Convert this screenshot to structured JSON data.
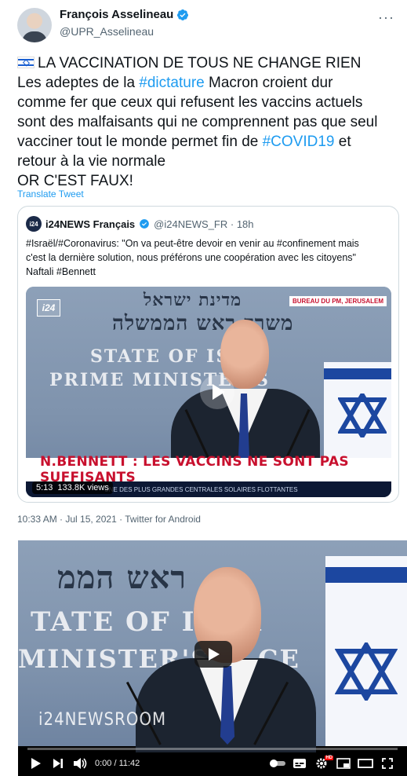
{
  "tweet": {
    "author_name": "François Asselineau",
    "handle": "@UPR_Asselineau",
    "more_label": "···",
    "lines": [
      {
        "before": "LA VACCINATION DE TOUS NE CHANGE RIEN"
      },
      {
        "before": "Les adeptes de la ",
        "hashtag": "#dictature",
        "after": " Macron croient dur"
      },
      {
        "before": "comme fer que ceux qui refusent les vaccins actuels"
      },
      {
        "before": "sont des malfaisants qui ne comprennent pas que seul"
      },
      {
        "before": "vacciner tout le monde permet fin de ",
        "hashtag": "#COVID19",
        "after": " et"
      },
      {
        "before": "retour à la vie normale"
      },
      {
        "before": "OR C'EST FAUX!"
      }
    ],
    "translate_label": "Translate Tweet",
    "timestamp": "10:33 AM · Jul 15, 2021 · Twitter for Android"
  },
  "quote": {
    "logo_text": "i24",
    "name": "i24NEWS Français",
    "meta": "@i24NEWS_FR · 18h",
    "text_lines": [
      "#Israël/#Coronavirus: \"On va peut-être devoir en venir au #confinement mais",
      "c'est la dernière solution, nous préférons une coopération avec les citoyens\"",
      "Naftali #Bennett"
    ],
    "media": {
      "channel_logo": "i24",
      "bureau_label": "BUREAU DU PM, JERUSALEM",
      "hebrew_line1": "מדינת ישראל",
      "hebrew_line2": "משרד ראש הממשלה",
      "english_line1": "STATE OF ISRA",
      "english_line2": "PRIME MINISTER'S",
      "banner": "N.BENNETT : LES VACCINS NE SONT PAS SUFFISANTS",
      "ticker": "UNE DES PLUS GRANDES CENTRALES SOLAIRES FLOTTANTES",
      "duration": "5:13",
      "views": "133.8K views"
    }
  },
  "video": {
    "hebrew_line": "ראש הממ",
    "english_line1": "TATE OF ISRA",
    "english_line2": "MINISTER'S",
    "english_line2_end": "CE",
    "watermark": "i24NEWSROOM",
    "time": "0:00 / 11:42",
    "progress": 0,
    "hd_label": "HD"
  },
  "colors": {
    "link": "#1d9bf0",
    "banner_red": "#c8102e",
    "flag_blue": "#1c47a0"
  }
}
